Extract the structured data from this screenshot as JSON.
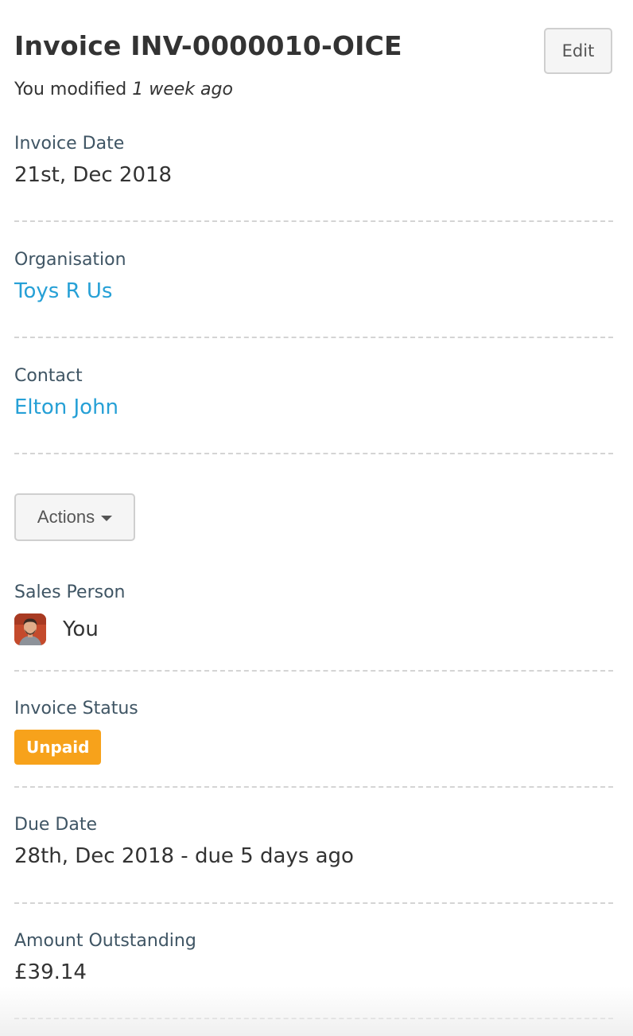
{
  "header": {
    "title": "Invoice INV-0000010-OICE",
    "edit_label": "Edit",
    "modified_prefix": "You modified",
    "modified_time": "1 week ago"
  },
  "invoice_date": {
    "label": "Invoice Date",
    "value": "21st, Dec 2018"
  },
  "organisation": {
    "label": "Organisation",
    "value": "Toys R Us"
  },
  "contact": {
    "label": "Contact",
    "value": "Elton John"
  },
  "actions": {
    "label": "Actions",
    "icon": "caret-down-icon"
  },
  "sales_person": {
    "label": "Sales Person",
    "value": "You",
    "avatar_icon": "user-avatar"
  },
  "invoice_status": {
    "label": "Invoice Status",
    "value": "Unpaid",
    "color": "#f7a21b"
  },
  "due_date": {
    "label": "Due Date",
    "value": "28th, Dec 2018 - due 5 days ago"
  },
  "amount_outstanding": {
    "label": "Amount Outstanding",
    "value": "£39.14"
  },
  "colors": {
    "link": "#26a0d6",
    "label": "#3f5564",
    "text": "#333333",
    "badge": "#f7a21b"
  }
}
